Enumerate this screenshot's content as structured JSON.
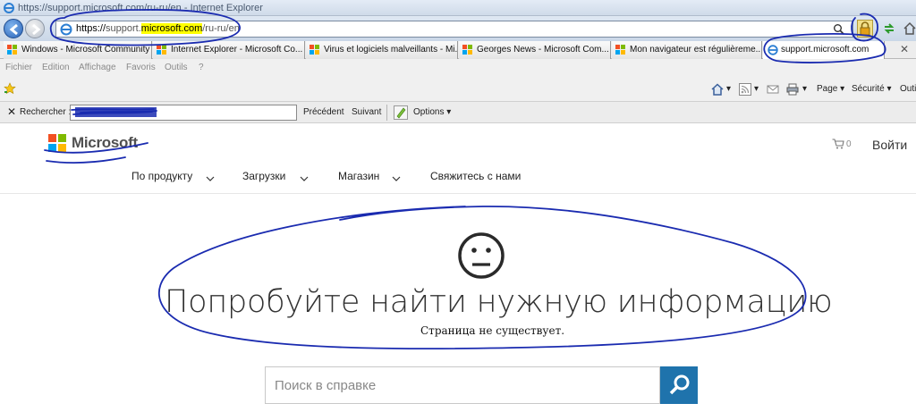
{
  "window": {
    "title": "https://support.microsoft.com/ru-ru/en - Internet Explorer"
  },
  "address_bar": {
    "url_scheme": "https://",
    "url_prefix": "support.",
    "url_host": "microsoft.com",
    "url_path": "/ru-ru/en"
  },
  "tabs": [
    {
      "label": "Windows - Microsoft Community",
      "active": false
    },
    {
      "label": "Internet Explorer - Microsoft Co...",
      "active": false
    },
    {
      "label": "Virus et logiciels malveillants - Mi...",
      "active": false
    },
    {
      "label": "Georges News - Microsoft Com...",
      "active": false
    },
    {
      "label": "Mon navigateur est régulièreme...",
      "active": false
    },
    {
      "label": "support.microsoft.com",
      "active": true
    }
  ],
  "tab_close": "✕",
  "menu": [
    "Fichier",
    "Edition",
    "Affichage",
    "Favoris",
    "Outils",
    "?"
  ],
  "command_bar": {
    "page": "Page",
    "security": "Sécurité",
    "tools": "Outi"
  },
  "find_bar": {
    "close": "✕",
    "label": "Rechercher :",
    "previous": "Précédent",
    "next": "Suivant",
    "options": "Options"
  },
  "site": {
    "brand": "Microsoft",
    "cart_count": "0",
    "sign_in": "Войти",
    "nav": [
      "По продукту",
      "Загрузки",
      "Магазин",
      "Свяжитесь с нами"
    ],
    "headline": "Попробуйте найти нужную информацию",
    "subline": "Страница не существует.",
    "search_placeholder": "Поиск в справке"
  },
  "colors": {
    "ms_red": "#f25022",
    "ms_green": "#7fba00",
    "ms_blue": "#00a4ef",
    "ms_yellow": "#ffb900",
    "search_button": "#1f73ac",
    "annotation_ink": "#1a2bb0",
    "url_highlight": "#ffff00"
  },
  "icons": {
    "back": "back-arrow-icon",
    "forward": "forward-arrow-icon",
    "lock": "lock-icon",
    "refresh": "refresh-icon",
    "home": "home-icon",
    "favorites": "favorites-star-icon",
    "cart": "shopping-cart-icon",
    "search": "magnifier-icon",
    "sad_face": "sad-face-icon"
  }
}
